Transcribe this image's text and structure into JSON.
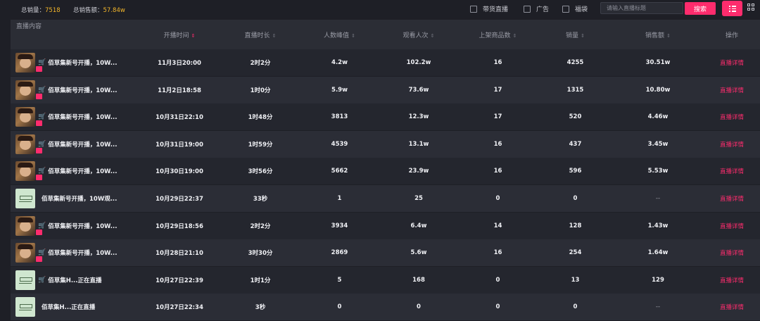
{
  "summary": {
    "sales_label": "总销量：",
    "sales_value": "7518",
    "gmv_label": "总销售额：",
    "gmv_value": "57.84w"
  },
  "filters": [
    {
      "label": "带货直播",
      "checked": false
    },
    {
      "label": "广告",
      "checked": false
    },
    {
      "label": "福袋",
      "checked": false
    }
  ],
  "search": {
    "placeholder": "请输入直播标题",
    "button_label": "搜索"
  },
  "view_toggle": {
    "list_icon": "list-icon",
    "grid_icon": "grid-icon",
    "active": "list"
  },
  "colors": {
    "accent": "#fe2c6d",
    "gold": "#f2b52a",
    "bg": "#1e1f26"
  },
  "table": {
    "columns": [
      {
        "label": "直播内容",
        "sort": null
      },
      {
        "label": "开播时间",
        "sort": "active"
      },
      {
        "label": "直播时长",
        "sort": "default"
      },
      {
        "label": "人数峰值",
        "sort": "default"
      },
      {
        "label": "观看人次",
        "sort": "default"
      },
      {
        "label": "上架商品数",
        "sort": "default"
      },
      {
        "label": "销量",
        "sort": "default"
      },
      {
        "label": "销售额",
        "sort": "default"
      },
      {
        "label": "操作",
        "sort": null
      }
    ],
    "rows": [
      {
        "thumb": "face",
        "cart": true,
        "gift": true,
        "title": "佰草集新号开播，10W...",
        "start": "11月3日20:00",
        "duration": "2时2分",
        "peak": "4.2w",
        "views": "102.2w",
        "products": "16",
        "sales": "4255",
        "gmv": "30.51w",
        "action": "直播详情"
      },
      {
        "thumb": "face",
        "cart": true,
        "gift": true,
        "title": "佰草集新号开播，10W...",
        "start": "11月2日18:58",
        "duration": "1时0分",
        "peak": "5.9w",
        "views": "73.6w",
        "products": "17",
        "sales": "1315",
        "gmv": "10.80w",
        "action": "直播详情"
      },
      {
        "thumb": "face",
        "cart": true,
        "gift": true,
        "title": "佰草集新号开播，10W...",
        "start": "10月31日22:10",
        "duration": "1时48分",
        "peak": "3813",
        "views": "12.3w",
        "products": "17",
        "sales": "520",
        "gmv": "4.46w",
        "action": "直播详情"
      },
      {
        "thumb": "face",
        "cart": true,
        "gift": true,
        "title": "佰草集新号开播，10W...",
        "start": "10月31日19:00",
        "duration": "1时59分",
        "peak": "4539",
        "views": "13.1w",
        "products": "16",
        "sales": "437",
        "gmv": "3.45w",
        "action": "直播详情"
      },
      {
        "thumb": "face",
        "cart": true,
        "gift": true,
        "title": "佰草集新号开播，10W...",
        "start": "10月30日19:00",
        "duration": "3时56分",
        "peak": "5662",
        "views": "23.9w",
        "products": "16",
        "sales": "596",
        "gmv": "5.53w",
        "action": "直播详情"
      },
      {
        "thumb": "logo",
        "cart": false,
        "gift": false,
        "title": "佰草集新号开播，10W观...",
        "start": "10月29日22:37",
        "duration": "33秒",
        "peak": "1",
        "views": "25",
        "products": "0",
        "sales": "0",
        "gmv": "--",
        "action": "直播详情"
      },
      {
        "thumb": "face",
        "cart": true,
        "gift": true,
        "title": "佰草集新号开播，10W...",
        "start": "10月29日18:56",
        "duration": "2时2分",
        "peak": "3934",
        "views": "6.4w",
        "products": "14",
        "sales": "128",
        "gmv": "1.43w",
        "action": "直播详情"
      },
      {
        "thumb": "face",
        "cart": true,
        "gift": true,
        "title": "佰草集新号开播，10W...",
        "start": "10月28日21:10",
        "duration": "3时30分",
        "peak": "2869",
        "views": "5.6w",
        "products": "16",
        "sales": "254",
        "gmv": "1.64w",
        "action": "直播详情"
      },
      {
        "thumb": "logo",
        "cart": true,
        "gift": false,
        "title": "佰草集H...正在直播",
        "start": "10月27日22:39",
        "duration": "1时1分",
        "peak": "5",
        "views": "168",
        "products": "0",
        "sales": "13",
        "gmv": "129",
        "action": "直播详情"
      },
      {
        "thumb": "logo",
        "cart": false,
        "gift": false,
        "title": "佰草集H...正在直播",
        "start": "10月27日22:34",
        "duration": "3秒",
        "peak": "0",
        "views": "0",
        "products": "0",
        "sales": "0",
        "gmv": "--",
        "action": "直播详情"
      }
    ]
  }
}
